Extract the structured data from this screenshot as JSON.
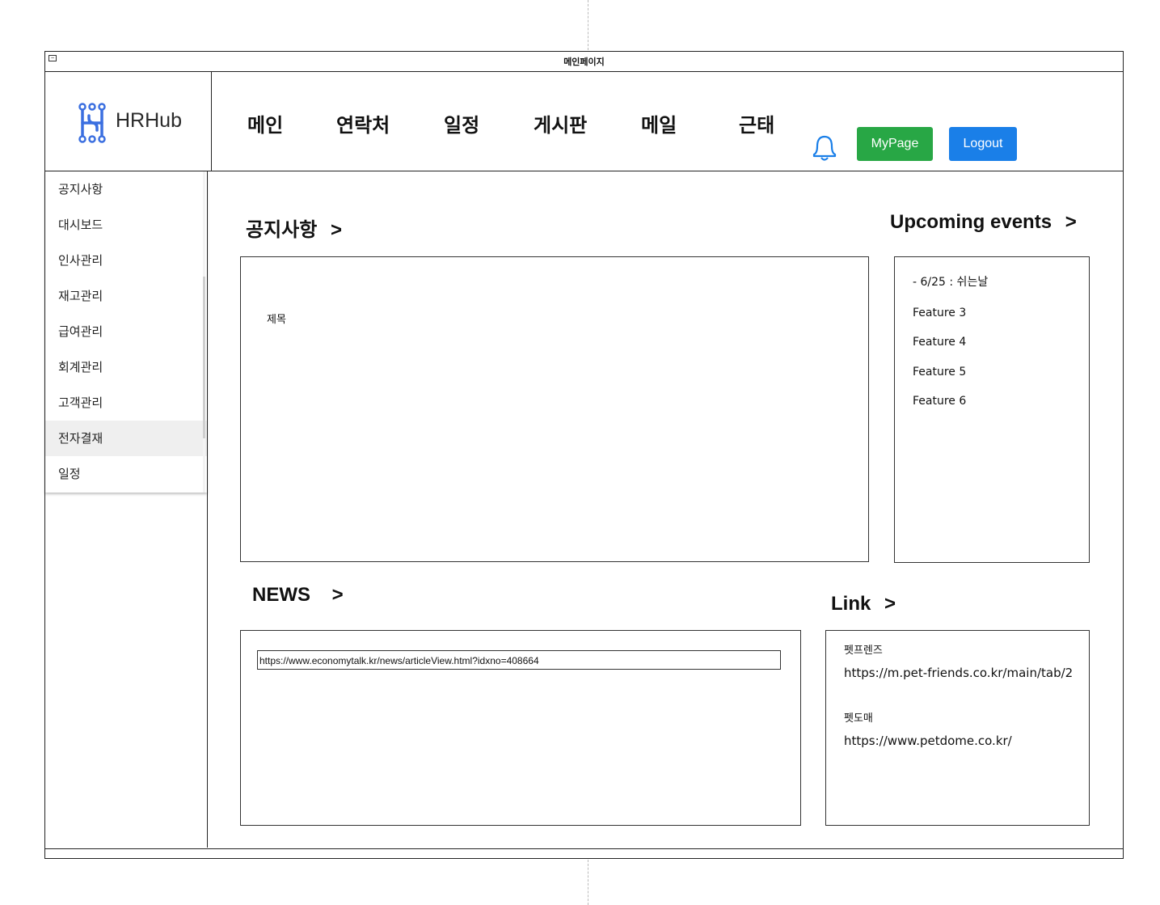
{
  "window": {
    "title": "메인페이지"
  },
  "header": {
    "logo_text": "HRHub",
    "nav": [
      "메인",
      "연락처",
      "일정",
      "게시판",
      "메일",
      "근태"
    ],
    "mypage_label": "MyPage",
    "logout_label": "Logout",
    "icons": {
      "logo": "hrhub-logo-icon",
      "notification": "bell-icon"
    },
    "colors": {
      "mypage": "#28a745",
      "logout": "#1a7fe8",
      "bell": "#1a7fe8",
      "logo": "#3b6fe0"
    }
  },
  "sidebar": {
    "items": [
      "공지사항",
      "대시보드",
      "인사관리",
      "재고관리",
      "급여관리",
      "회계관리",
      "고객관리",
      "전자결재",
      "일정"
    ],
    "active": "전자결재"
  },
  "notice": {
    "title": "공지사항",
    "arrow": ">",
    "field_label": "제목"
  },
  "events": {
    "title": "Upcoming events",
    "arrow": ">",
    "items": [
      "- 6/25 : 쉬는날",
      "Feature 3",
      "Feature 4",
      "Feature 5",
      "Feature 6"
    ]
  },
  "news": {
    "title": "NEWS",
    "arrow": ">",
    "url": "https://www.economytalk.kr/news/articleView.html?idxno=408664"
  },
  "links": {
    "title": "Link",
    "arrow": ">",
    "items": [
      {
        "label": "펫프렌즈",
        "url": "https://m.pet-friends.co.kr/main/tab/2"
      },
      {
        "label": "펫도매",
        "url": "https://www.petdome.co.kr/"
      }
    ]
  }
}
